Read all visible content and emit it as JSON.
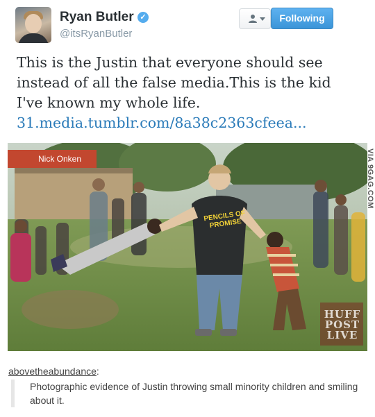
{
  "tweet": {
    "display_name": "Ryan Butler",
    "screen_name": "@itsRyanButler",
    "follow_button_label": "Following",
    "text": "This is the Justin that everyone should see instead of all the false media.This is the kid I've known my whole life.",
    "link_text": "31.media.tumblr.com/8a38c2363cfeea..."
  },
  "photo": {
    "caption": "Nick Onken",
    "shirt_text": "PENCILS OF PROMISE",
    "watermark": "HUFF POST LIVE",
    "side_url": "VIA 9GAG.COM"
  },
  "comment": {
    "username": "abovetheabundance",
    "text": "Photographic evidence of Justin throwing small minority children and smiling about it."
  },
  "colors": {
    "follow_button": "#3b95d8",
    "link": "#2b7bb9",
    "verified_badge": "#55acee",
    "photo_caption_bg": "#c2472f"
  },
  "icons": {
    "verified": "verified-badge-icon",
    "user_menu": "person-icon"
  }
}
